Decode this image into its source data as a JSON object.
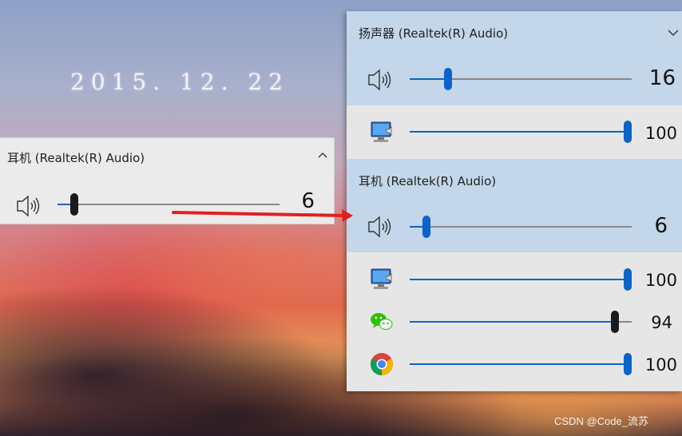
{
  "desktop": {
    "date": "2015. 12. 22",
    "watermark": "CSDN @Code_流苏"
  },
  "small_flyout": {
    "device_name": "耳机 (Realtek(R) Audio)",
    "volume": 6,
    "volume_text": "6",
    "expand_icon": "chevron-up-icon"
  },
  "big_flyout": {
    "devices": [
      {
        "device_name": "扬声器 (Realtek(R) Audio)",
        "volume": 16,
        "volume_text": "16",
        "apps": [
          {
            "icon": "system-sounds-icon",
            "volume": 100,
            "volume_text": "100"
          }
        ]
      },
      {
        "device_name": "耳机 (Realtek(R) Audio)",
        "volume": 6,
        "volume_text": "6",
        "apps": [
          {
            "icon": "system-sounds-icon",
            "volume": 100,
            "volume_text": "100"
          },
          {
            "icon": "wechat-icon",
            "volume": 94,
            "volume_text": "94"
          },
          {
            "icon": "chrome-icon",
            "volume": 100,
            "volume_text": "100"
          }
        ]
      }
    ],
    "expand_icon": "chevron-down-icon"
  },
  "colors": {
    "accent": "#0a64c8",
    "highlight": "#c3d6ea",
    "annotation_arrow": "#e02020"
  }
}
